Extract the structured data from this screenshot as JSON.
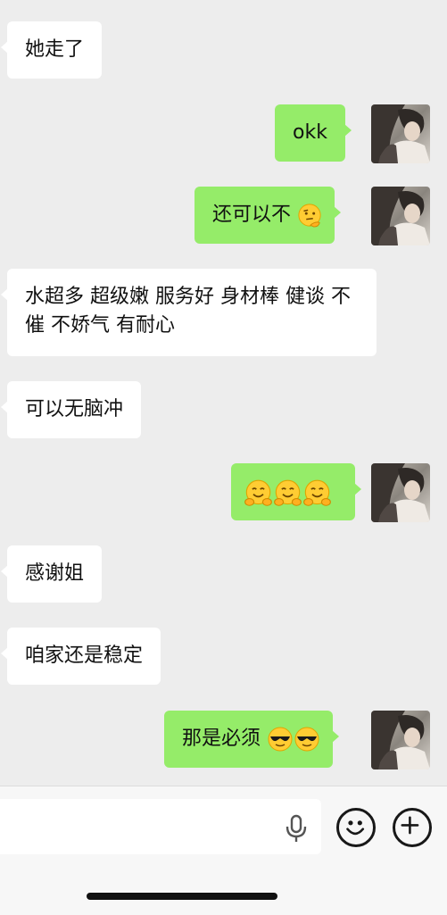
{
  "messages": [
    {
      "side": "in",
      "text": "她走了"
    },
    {
      "side": "out",
      "text": "okk"
    },
    {
      "side": "out",
      "text": "还可以不",
      "emoji": [
        "thinking-face-emoji"
      ]
    },
    {
      "side": "in",
      "text": "水超多 超级嫩 服务好 身材棒 健谈 不催 不娇气 有耐心"
    },
    {
      "side": "in",
      "text": "可以无脑冲"
    },
    {
      "side": "out",
      "text": "",
      "emoji": [
        "hugging-face-emoji",
        "hugging-face-emoji",
        "hugging-face-emoji"
      ]
    },
    {
      "side": "in",
      "text": "感谢姐"
    },
    {
      "side": "in",
      "text": "咱家还是稳定"
    },
    {
      "side": "out",
      "text": "那是必须",
      "emoji": [
        "sunglasses-face-emoji",
        "sunglasses-face-emoji"
      ]
    }
  ],
  "input_bar": {
    "placeholder": "",
    "icons": [
      "microphone-icon",
      "smiley-icon",
      "plus-icon"
    ]
  },
  "colors": {
    "background": "#ededed",
    "incoming_bubble": "#ffffff",
    "outgoing_bubble": "#95ec69",
    "input_bar": "#f7f7f7"
  }
}
